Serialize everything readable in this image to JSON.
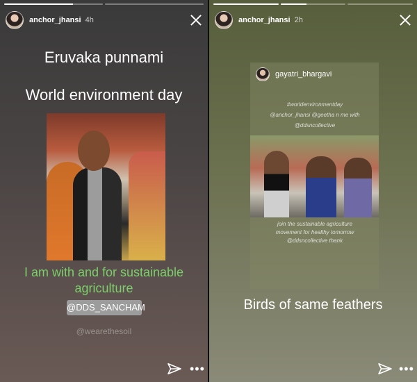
{
  "stories": [
    {
      "username": "anchor_jhansi",
      "time": "4h",
      "title1": "Eruvaka punnami",
      "title2": "World environment day",
      "caption": [
        "I am with and for sustainable",
        "agriculture"
      ],
      "tag": "@DDS_SANCHAM",
      "mention": "@wearethesoil"
    },
    {
      "username": "anchor_jhansi",
      "time": "2h",
      "shared_username": "gayatri_bhargavi",
      "shared_text": [
        "#worldenvironmentday",
        "@anchor_jhansi @geetha n me with",
        "@ddsncollective",
        "join the sustainable agriculture",
        "movement for healthy tomorrow",
        "@ddsncollective thank"
      ],
      "caption": "Birds of same feathers"
    }
  ],
  "colors": {
    "green_caption": "#7ccf6a",
    "tag_bg": "#9c9c9c"
  },
  "icons": {
    "send": "send-icon",
    "more": "more-icon",
    "close": "close-icon"
  },
  "progress": [
    0.7,
    0.4
  ]
}
